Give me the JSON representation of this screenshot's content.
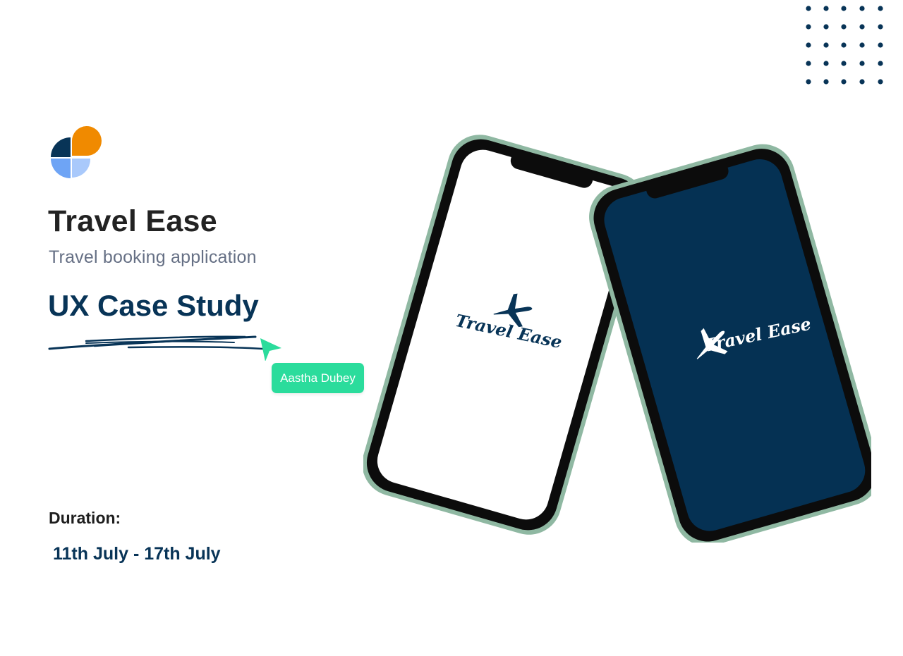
{
  "brand": {
    "title": "Travel Ease",
    "subtitle": "Travel booking application"
  },
  "case_study": {
    "heading": "UX Case Study",
    "author": "Aastha Dubey"
  },
  "duration": {
    "label": "Duration:",
    "value": "11th July - 17th July"
  },
  "phones": {
    "light_screen_logo_text": "Travel Ease",
    "dark_screen_logo_text": "Travel Ease"
  },
  "colors": {
    "navy": "#083457",
    "orange": "#f08a00",
    "light_blue": "#6ea4f5",
    "pale_blue": "#a9c9fb",
    "mint": "#2bdc9c",
    "phone_frame": "#8fb8a2",
    "dark_screen": "#053153"
  },
  "icons": {
    "logo": "travel-ease-logo-icon",
    "cursor": "cursor-arrow-icon",
    "plane": "airplane-icon",
    "decor": "dot-grid-icon"
  }
}
